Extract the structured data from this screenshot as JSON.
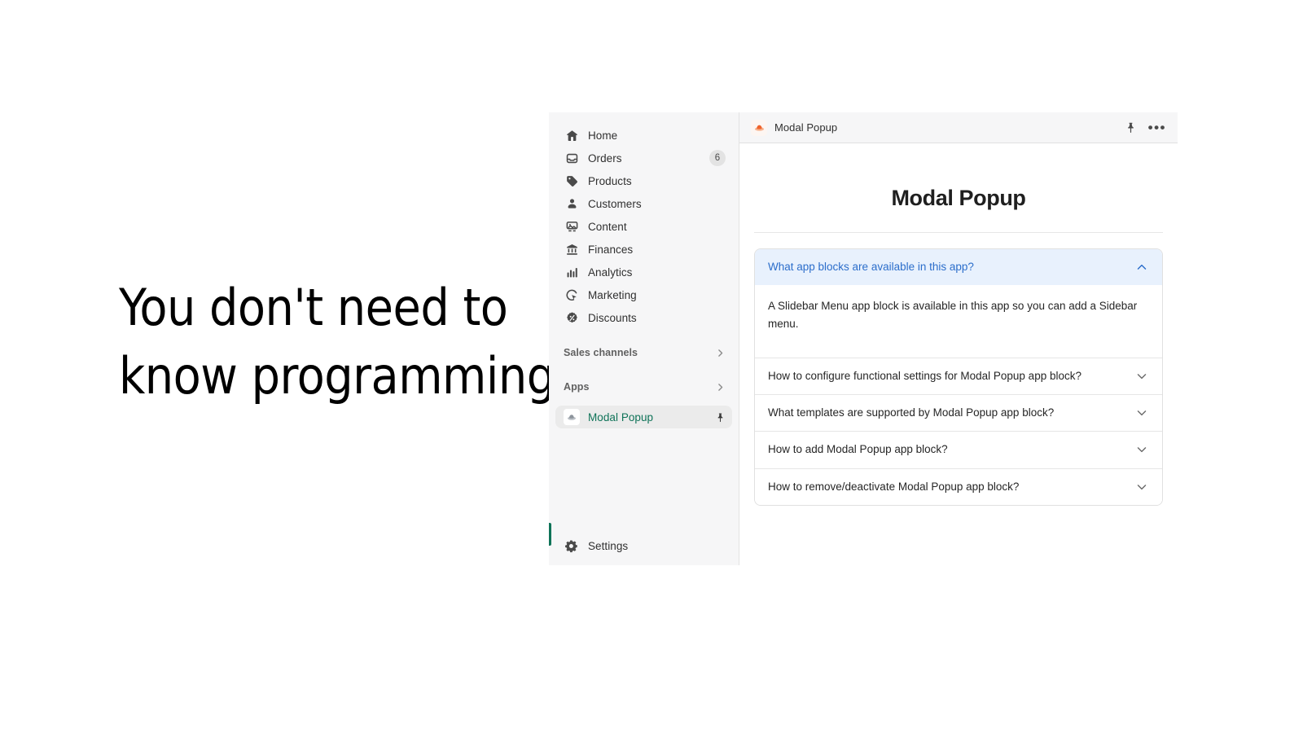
{
  "headline": {
    "line1": "You don't need to",
    "line2": "know programming!"
  },
  "sidebar": {
    "items": [
      {
        "label": "Home",
        "icon": "home-icon",
        "badge": null
      },
      {
        "label": "Orders",
        "icon": "orders-inbox-icon",
        "badge": "6"
      },
      {
        "label": "Products",
        "icon": "products-tag-icon",
        "badge": null
      },
      {
        "label": "Customers",
        "icon": "customers-person-icon",
        "badge": null
      },
      {
        "label": "Content",
        "icon": "content-image-icon",
        "badge": null
      },
      {
        "label": "Finances",
        "icon": "finances-bank-icon",
        "badge": null
      },
      {
        "label": "Analytics",
        "icon": "analytics-bars-icon",
        "badge": null
      },
      {
        "label": "Marketing",
        "icon": "marketing-target-icon",
        "badge": null
      },
      {
        "label": "Discounts",
        "icon": "discounts-percent-icon",
        "badge": null
      }
    ],
    "sections": [
      {
        "label": "Sales channels",
        "icon": "chevron-right-icon"
      },
      {
        "label": "Apps",
        "icon": "chevron-right-icon"
      }
    ],
    "selected_app": {
      "label": "Modal Popup",
      "icon": "modal-popup-app-icon",
      "pin_icon": "pin-icon",
      "accent_color": "#0f7358"
    },
    "settings": {
      "label": "Settings",
      "icon": "gear-icon"
    }
  },
  "topbar": {
    "title": "Modal Popup",
    "app_icon": "modal-popup-app-icon",
    "pin_icon": "pin-icon",
    "more_icon": "more-horizontal-icon"
  },
  "page": {
    "title": "Modal Popup"
  },
  "accordion": {
    "items": [
      {
        "question": "What app blocks are available in this app?",
        "answer": "A Slidebar Menu app block is available in this app so you can add a Sidebar menu.",
        "open": true,
        "chevron": "chevron-up-icon"
      },
      {
        "question": "How to configure functional settings for Modal Popup app block?",
        "answer": "",
        "open": false,
        "chevron": "chevron-down-icon"
      },
      {
        "question": "What templates are supported by Modal Popup app block?",
        "answer": "",
        "open": false,
        "chevron": "chevron-down-icon"
      },
      {
        "question": "How to add Modal Popup app block?",
        "answer": "",
        "open": false,
        "chevron": "chevron-down-icon"
      },
      {
        "question": "How to remove/deactivate Modal Popup app block?",
        "answer": "",
        "open": false,
        "chevron": "chevron-down-icon"
      }
    ]
  },
  "colors": {
    "accent_green": "#0f7358",
    "accent_blue": "#2c6ecb",
    "accent_blue_bg": "#e8f1fd",
    "sidebar_bg": "#f6f6f7",
    "app_icon_orange": "#f0622a"
  }
}
